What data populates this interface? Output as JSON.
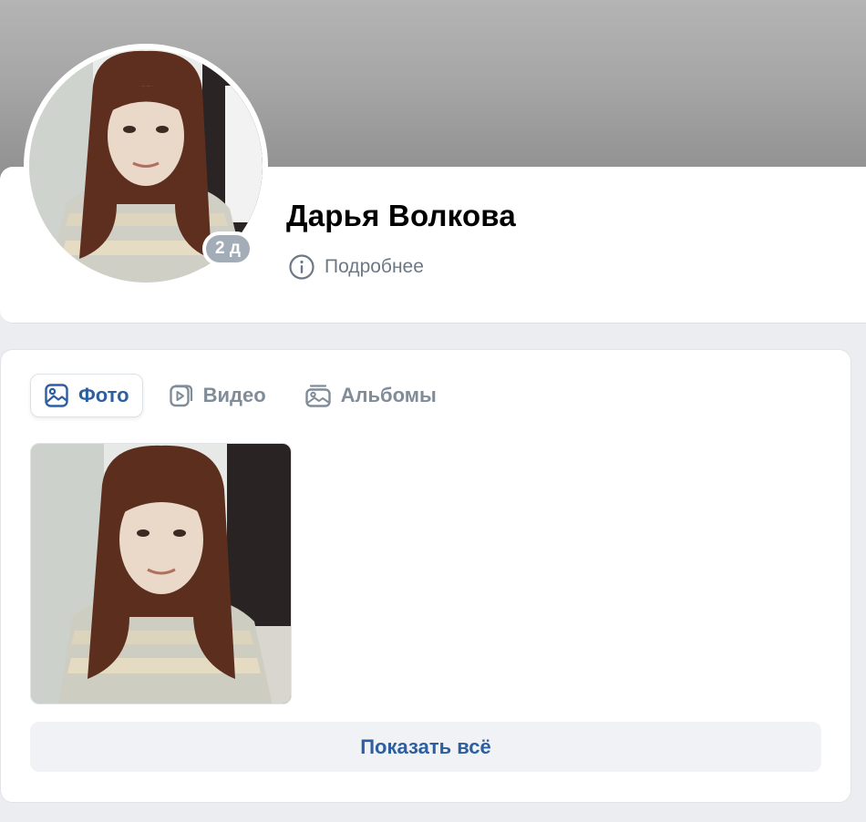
{
  "profile": {
    "name": "Дарья Волкова",
    "online_badge": "2 д",
    "more_label": "Подробнее"
  },
  "media": {
    "tabs": [
      {
        "label": "Фото",
        "icon": "image-icon",
        "active": true
      },
      {
        "label": "Видео",
        "icon": "video-icon",
        "active": false
      },
      {
        "label": "Альбомы",
        "icon": "album-icon",
        "active": false
      }
    ],
    "show_all_label": "Показать всё"
  },
  "colors": {
    "accent": "#2d5ea0",
    "muted_text": "#818c99",
    "page_background": "#ebedf0",
    "badge": "#a3adb8"
  }
}
